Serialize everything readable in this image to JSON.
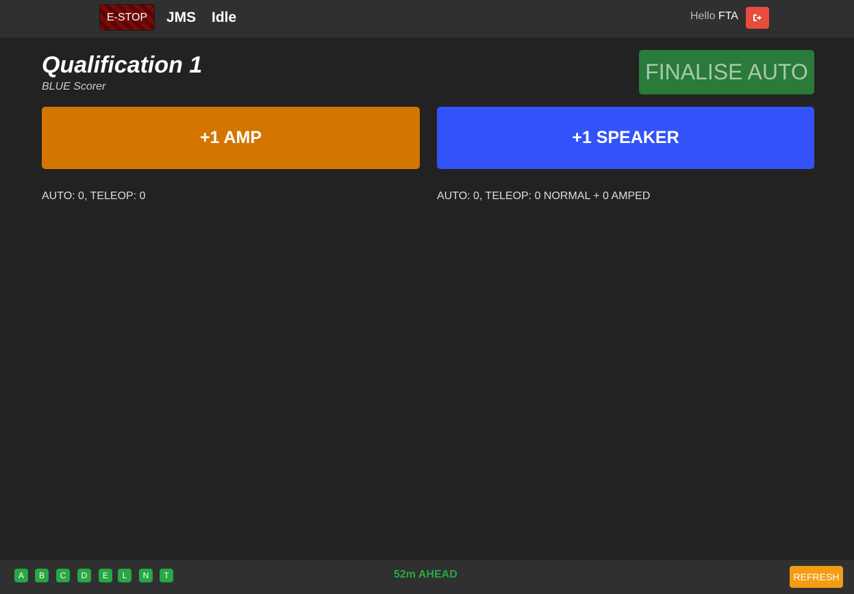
{
  "navbar": {
    "estop_label": "E-STOP",
    "brand": "JMS",
    "state": "Idle",
    "greeting": "Hello",
    "user": "FTA",
    "logout_icon": "sign-out-icon"
  },
  "match": {
    "title": "Qualification 1",
    "subtitle": "BLUE Scorer",
    "finalise_label": "FINALISE AUTO"
  },
  "buttons": {
    "amp_label": "+1 AMP",
    "speaker_label": "+1 SPEAKER"
  },
  "scores": {
    "amp_text": "AUTO: 0, TELEOP: 0",
    "speaker_text": "AUTO: 0, TELEOP: 0 NORMAL + 0 AMPED"
  },
  "footer": {
    "status_pills": [
      "A",
      "B",
      "C",
      "D",
      "E",
      "L",
      "N",
      "T"
    ],
    "schedule_status": "52m AHEAD",
    "refresh_label": "REFRESH"
  },
  "colors": {
    "background": "#222222",
    "navbar": "#303030",
    "amp": "#d47500",
    "speaker": "#3452f9",
    "finalise": "#2a7a3a",
    "status_ok": "#28a745",
    "refresh": "#f39c12",
    "logout": "#e74c3c"
  }
}
